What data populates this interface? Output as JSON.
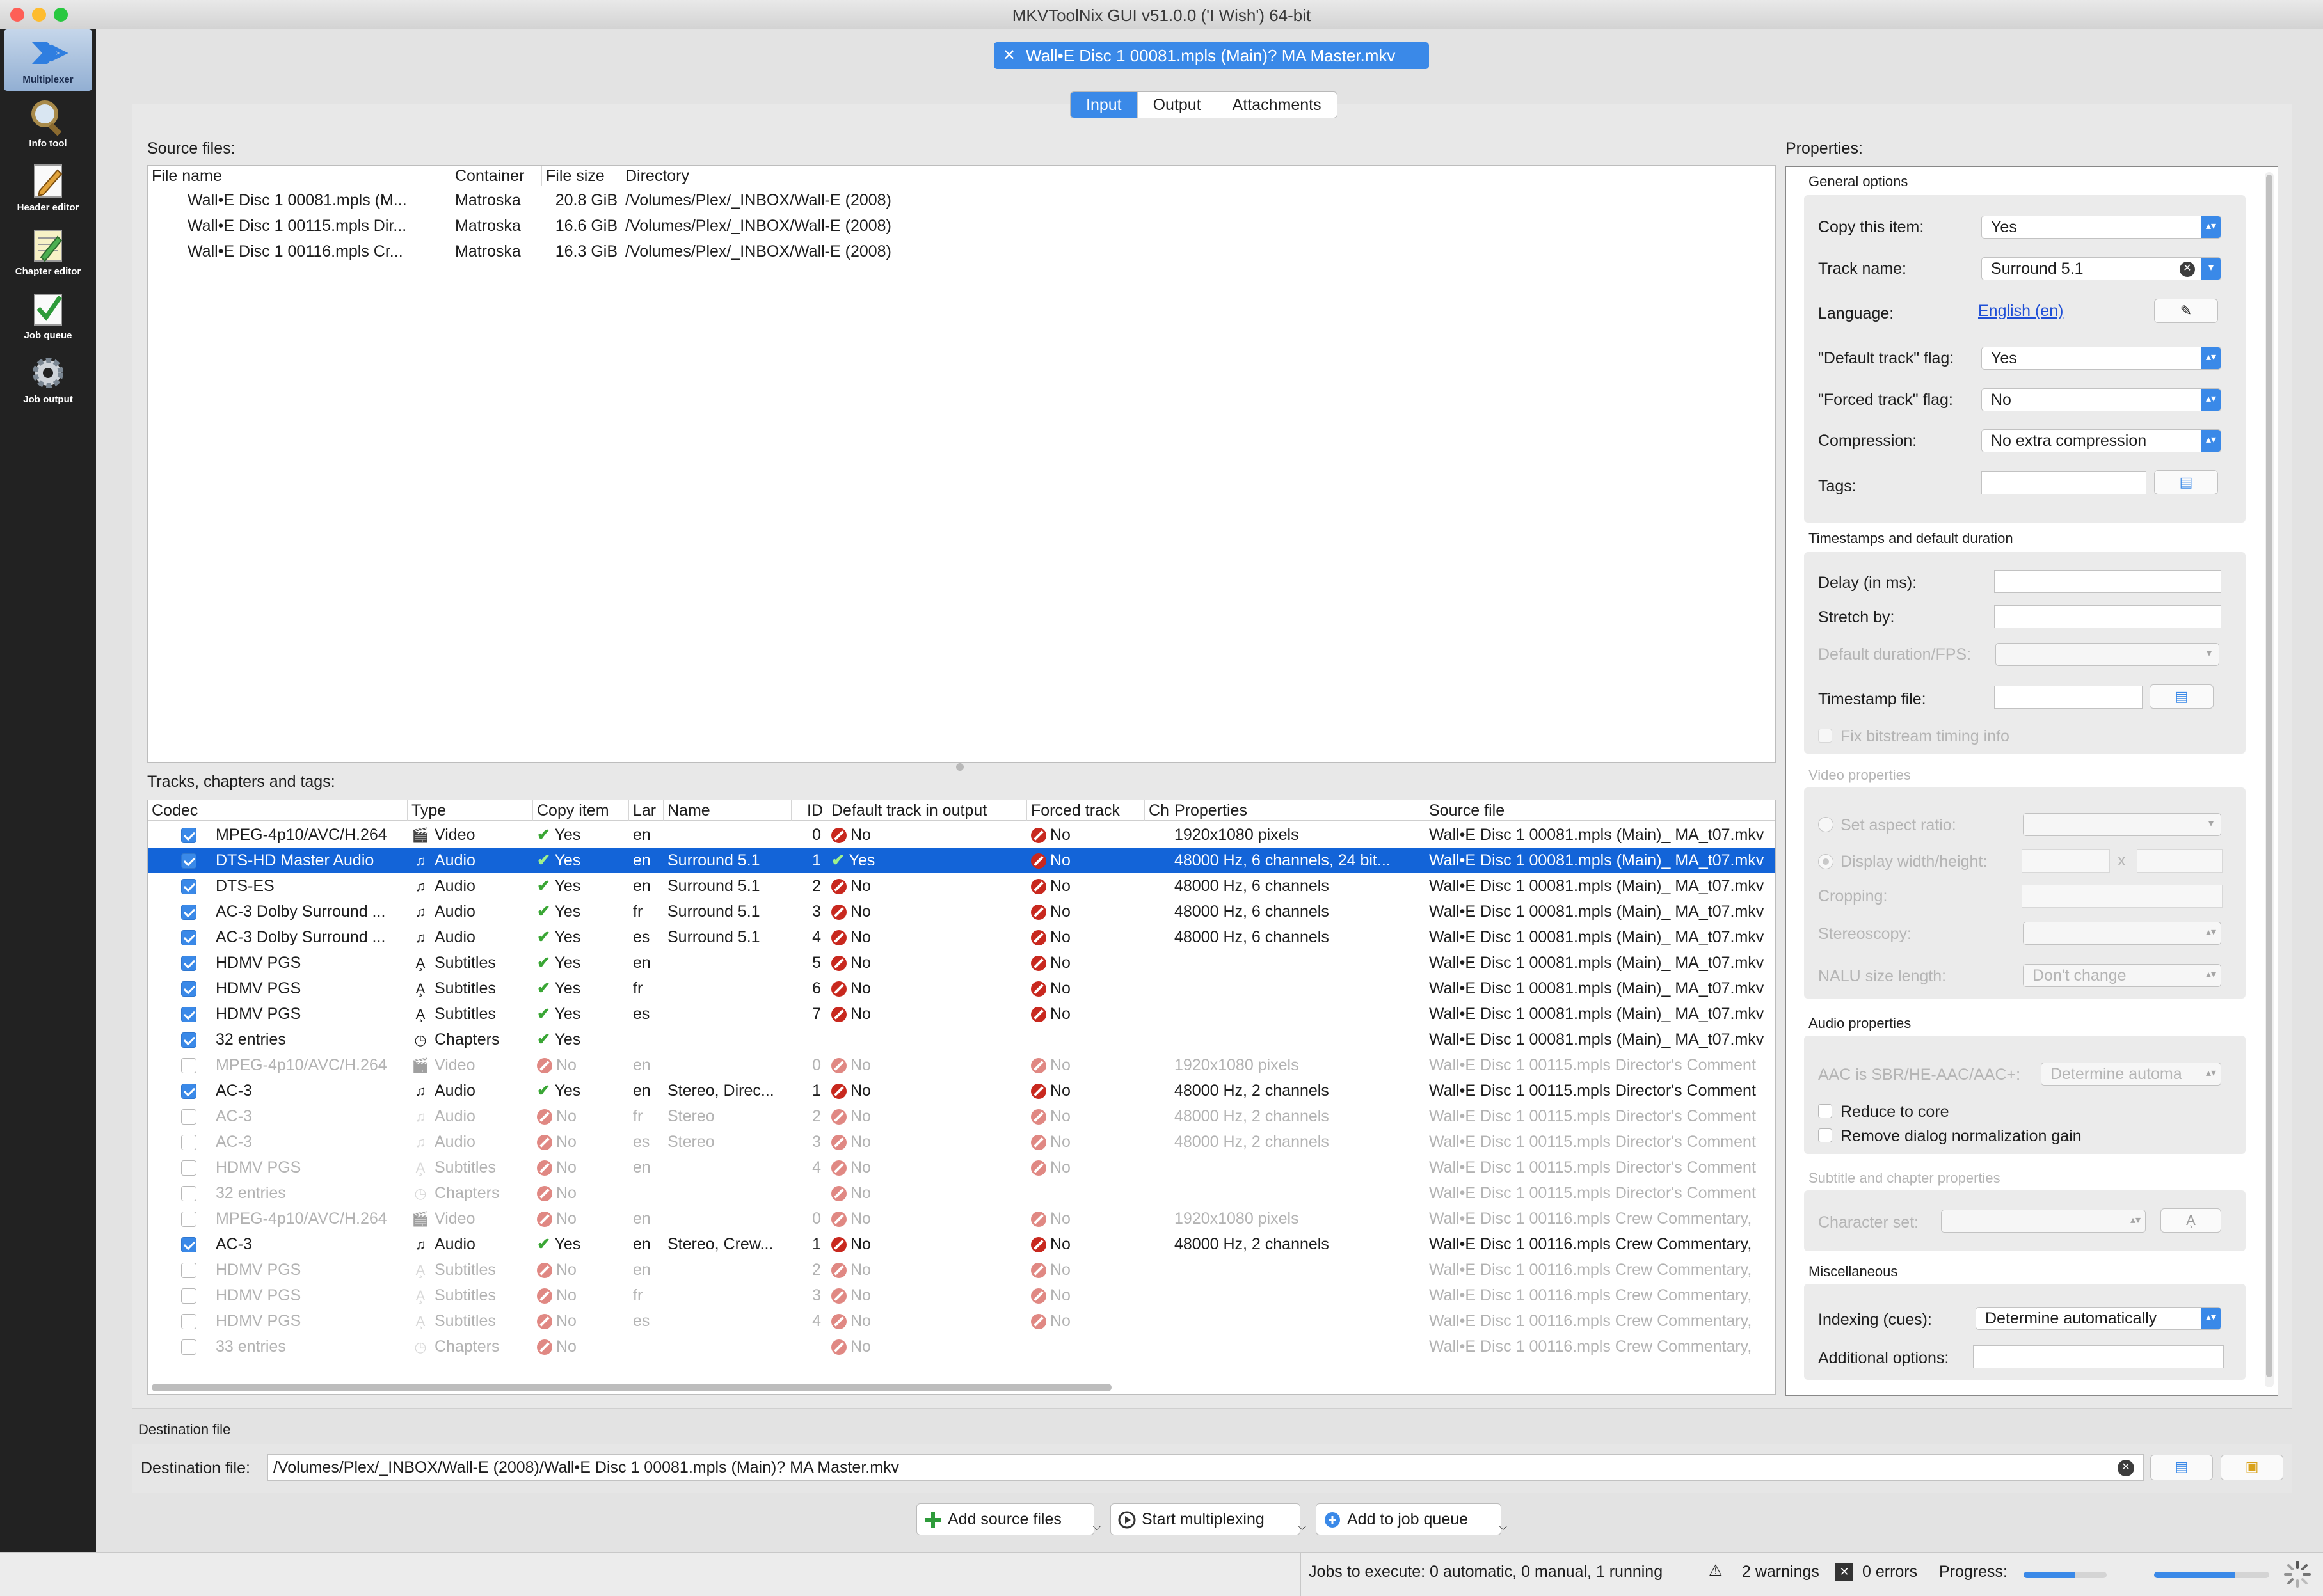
{
  "window": {
    "title": "MKVToolNix GUI v51.0.0 ('I Wish') 64-bit"
  },
  "sidebar": {
    "items": [
      {
        "label": "Multiplexer"
      },
      {
        "label": "Info tool"
      },
      {
        "label": "Header editor"
      },
      {
        "label": "Chapter editor"
      },
      {
        "label": "Job queue"
      },
      {
        "label": "Job output"
      }
    ]
  },
  "file_tab": {
    "label": "Wall•E Disc 1 00081.mpls (Main)? MA Master.mkv",
    "close": "✕"
  },
  "tabs": [
    {
      "label": "Input"
    },
    {
      "label": "Output"
    },
    {
      "label": "Attachments"
    }
  ],
  "source_files": {
    "label": "Source files:",
    "columns": [
      "File name",
      "Container",
      "File size",
      "Directory"
    ],
    "rows": [
      {
        "name": "Wall•E Disc 1 00081.mpls (M...",
        "container": "Matroska",
        "size": "20.8 GiB",
        "dir": "/Volumes/Plex/_INBOX/Wall-E (2008)"
      },
      {
        "name": "Wall•E Disc 1 00115.mpls Dir...",
        "container": "Matroska",
        "size": "16.6 GiB",
        "dir": "/Volumes/Plex/_INBOX/Wall-E (2008)"
      },
      {
        "name": "Wall•E Disc 1 00116.mpls Cr...",
        "container": "Matroska",
        "size": "16.3 GiB",
        "dir": "/Volumes/Plex/_INBOX/Wall-E (2008)"
      }
    ]
  },
  "tracks": {
    "label": "Tracks, chapters and tags:",
    "columns": [
      "Codec",
      "Type",
      "Copy item",
      "Lar",
      "Name",
      "ID",
      "Default track in output",
      "Forced track",
      "Ch",
      "Properties",
      "Source file"
    ],
    "rows": [
      {
        "checked": true,
        "codec": "MPEG-4p10/AVC/H.264",
        "type": "Video",
        "icon": "video",
        "copy": "Yes",
        "lang": "en",
        "name": "",
        "id": "0",
        "def": "No",
        "forced": "No",
        "props": "1920x1080 pixels",
        "src": "Wall•E Disc 1 00081.mpls (Main)_ MA_t07.mkv"
      },
      {
        "checked": true,
        "selected": true,
        "codec": "DTS-HD Master Audio",
        "type": "Audio",
        "icon": "audio",
        "copy": "Yes",
        "lang": "en",
        "name": "Surround 5.1",
        "id": "1",
        "def": "Yes",
        "forced": "No",
        "props": "48000 Hz, 6 channels, 24 bit...",
        "src": "Wall•E Disc 1 00081.mpls (Main)_ MA_t07.mkv"
      },
      {
        "checked": true,
        "codec": "DTS-ES",
        "type": "Audio",
        "icon": "audio",
        "copy": "Yes",
        "lang": "en",
        "name": "Surround 5.1",
        "id": "2",
        "def": "No",
        "forced": "No",
        "props": "48000 Hz, 6 channels",
        "src": "Wall•E Disc 1 00081.mpls (Main)_ MA_t07.mkv"
      },
      {
        "checked": true,
        "codec": "AC-3 Dolby Surround ...",
        "type": "Audio",
        "icon": "audio",
        "copy": "Yes",
        "lang": "fr",
        "name": "Surround 5.1",
        "id": "3",
        "def": "No",
        "forced": "No",
        "props": "48000 Hz, 6 channels",
        "src": "Wall•E Disc 1 00081.mpls (Main)_ MA_t07.mkv"
      },
      {
        "checked": true,
        "codec": "AC-3 Dolby Surround ...",
        "type": "Audio",
        "icon": "audio",
        "copy": "Yes",
        "lang": "es",
        "name": "Surround 5.1",
        "id": "4",
        "def": "No",
        "forced": "No",
        "props": "48000 Hz, 6 channels",
        "src": "Wall•E Disc 1 00081.mpls (Main)_ MA_t07.mkv"
      },
      {
        "checked": true,
        "codec": "HDMV PGS",
        "type": "Subtitles",
        "icon": "subs",
        "copy": "Yes",
        "lang": "en",
        "name": "",
        "id": "5",
        "def": "No",
        "forced": "No",
        "props": "",
        "src": "Wall•E Disc 1 00081.mpls (Main)_ MA_t07.mkv"
      },
      {
        "checked": true,
        "codec": "HDMV PGS",
        "type": "Subtitles",
        "icon": "subs",
        "copy": "Yes",
        "lang": "fr",
        "name": "",
        "id": "6",
        "def": "No",
        "forced": "No",
        "props": "",
        "src": "Wall•E Disc 1 00081.mpls (Main)_ MA_t07.mkv"
      },
      {
        "checked": true,
        "codec": "HDMV PGS",
        "type": "Subtitles",
        "icon": "subs",
        "copy": "Yes",
        "lang": "es",
        "name": "",
        "id": "7",
        "def": "No",
        "forced": "No",
        "props": "",
        "src": "Wall•E Disc 1 00081.mpls (Main)_ MA_t07.mkv"
      },
      {
        "checked": true,
        "codec": "32 entries",
        "type": "Chapters",
        "icon": "chap",
        "copy": "Yes",
        "lang": "",
        "name": "",
        "id": "",
        "def": "",
        "forced": "",
        "props": "",
        "src": "Wall•E Disc 1 00081.mpls (Main)_ MA_t07.mkv"
      },
      {
        "checked": false,
        "disabled": true,
        "codec": "MPEG-4p10/AVC/H.264",
        "type": "Video",
        "icon": "video",
        "copy": "No",
        "lang": "en",
        "name": "",
        "id": "0",
        "def": "No",
        "forced": "No",
        "props": "1920x1080 pixels",
        "src": "Wall•E Disc 1 00115.mpls Director's Comment"
      },
      {
        "checked": true,
        "codec": "AC-3",
        "type": "Audio",
        "icon": "audio",
        "copy": "Yes",
        "lang": "en",
        "name": "Stereo, Direc...",
        "id": "1",
        "def": "No",
        "forced": "No",
        "props": "48000 Hz, 2 channels",
        "src": "Wall•E Disc 1 00115.mpls Director's Comment"
      },
      {
        "checked": false,
        "disabled": true,
        "codec": "AC-3",
        "type": "Audio",
        "icon": "audio",
        "copy": "No",
        "lang": "fr",
        "name": "Stereo",
        "id": "2",
        "def": "No",
        "forced": "No",
        "props": "48000 Hz, 2 channels",
        "src": "Wall•E Disc 1 00115.mpls Director's Comment"
      },
      {
        "checked": false,
        "disabled": true,
        "codec": "AC-3",
        "type": "Audio",
        "icon": "audio",
        "copy": "No",
        "lang": "es",
        "name": "Stereo",
        "id": "3",
        "def": "No",
        "forced": "No",
        "props": "48000 Hz, 2 channels",
        "src": "Wall•E Disc 1 00115.mpls Director's Comment"
      },
      {
        "checked": false,
        "disabled": true,
        "codec": "HDMV PGS",
        "type": "Subtitles",
        "icon": "subs",
        "copy": "No",
        "lang": "en",
        "name": "",
        "id": "4",
        "def": "No",
        "forced": "No",
        "props": "",
        "src": "Wall•E Disc 1 00115.mpls Director's Comment"
      },
      {
        "checked": false,
        "disabled": true,
        "codec": "32 entries",
        "type": "Chapters",
        "icon": "chap",
        "copy": "No",
        "lang": "",
        "name": "",
        "id": "",
        "def": "No",
        "forced": "",
        "props": "",
        "src": "Wall•E Disc 1 00115.mpls Director's Comment"
      },
      {
        "checked": false,
        "disabled": true,
        "codec": "MPEG-4p10/AVC/H.264",
        "type": "Video",
        "icon": "video",
        "copy": "No",
        "lang": "en",
        "name": "",
        "id": "0",
        "def": "No",
        "forced": "No",
        "props": "1920x1080 pixels",
        "src": "Wall•E Disc 1 00116.mpls Crew Commentary,"
      },
      {
        "checked": true,
        "codec": "AC-3",
        "type": "Audio",
        "icon": "audio",
        "copy": "Yes",
        "lang": "en",
        "name": "Stereo, Crew...",
        "id": "1",
        "def": "No",
        "forced": "No",
        "props": "48000 Hz, 2 channels",
        "src": "Wall•E Disc 1 00116.mpls Crew Commentary,"
      },
      {
        "checked": false,
        "disabled": true,
        "codec": "HDMV PGS",
        "type": "Subtitles",
        "icon": "subs",
        "copy": "No",
        "lang": "en",
        "name": "",
        "id": "2",
        "def": "No",
        "forced": "No",
        "props": "",
        "src": "Wall•E Disc 1 00116.mpls Crew Commentary,"
      },
      {
        "checked": false,
        "disabled": true,
        "codec": "HDMV PGS",
        "type": "Subtitles",
        "icon": "subs",
        "copy": "No",
        "lang": "fr",
        "name": "",
        "id": "3",
        "def": "No",
        "forced": "No",
        "props": "",
        "src": "Wall•E Disc 1 00116.mpls Crew Commentary,"
      },
      {
        "checked": false,
        "disabled": true,
        "codec": "HDMV PGS",
        "type": "Subtitles",
        "icon": "subs",
        "copy": "No",
        "lang": "es",
        "name": "",
        "id": "4",
        "def": "No",
        "forced": "No",
        "props": "",
        "src": "Wall•E Disc 1 00116.mpls Crew Commentary,"
      },
      {
        "checked": false,
        "disabled": true,
        "codec": "33 entries",
        "type": "Chapters",
        "icon": "chap",
        "copy": "No",
        "lang": "",
        "name": "",
        "id": "",
        "def": "No",
        "forced": "",
        "props": "",
        "src": "Wall•E Disc 1 00116.mpls Crew Commentary,"
      }
    ]
  },
  "properties": {
    "label": "Properties:",
    "general": {
      "title": "General options",
      "copy_item_label": "Copy this item:",
      "copy_item_value": "Yes",
      "track_name_label": "Track name:",
      "track_name_value": "Surround 5.1",
      "language_label": "Language:",
      "language_value": "English (en)",
      "default_flag_label": "\"Default track\" flag:",
      "default_flag_value": "Yes",
      "forced_flag_label": "\"Forced track\" flag:",
      "forced_flag_value": "No",
      "compression_label": "Compression:",
      "compression_value": "No extra compression",
      "tags_label": "Tags:"
    },
    "timestamps": {
      "title": "Timestamps and default duration",
      "delay_label": "Delay (in ms):",
      "stretch_label": "Stretch by:",
      "default_duration_label": "Default duration/FPS:",
      "timestamp_file_label": "Timestamp file:",
      "fix_bitstream_label": "Fix bitstream timing info"
    },
    "video": {
      "title": "Video properties",
      "aspect_ratio_label": "Set aspect ratio:",
      "display_wh_label": "Display width/height:",
      "wh_separator": "x",
      "cropping_label": "Cropping:",
      "stereoscopy_label": "Stereoscopy:",
      "nalu_label": "NALU size length:",
      "nalu_value": "Don't change"
    },
    "audio": {
      "title": "Audio properties",
      "aac_label": "AAC is SBR/HE-AAC/AAC+:",
      "aac_value": "Determine automa",
      "reduce_core_label": "Reduce to core",
      "remove_dialog_label": "Remove dialog normalization gain"
    },
    "subtitle": {
      "title": "Subtitle and chapter properties",
      "charset_label": "Character set:"
    },
    "misc": {
      "title": "Miscellaneous",
      "indexing_label": "Indexing (cues):",
      "indexing_value": "Determine automatically",
      "additional_label": "Additional options:"
    }
  },
  "destination": {
    "section_label": "Destination file",
    "label": "Destination file:",
    "value": "/Volumes/Plex/_INBOX/Wall-E (2008)/Wall•E Disc 1 00081.mpls (Main)? MA Master.mkv"
  },
  "actions": {
    "add_source": "Add source files",
    "start_mux": "Start multiplexing",
    "add_queue": "Add to job queue"
  },
  "status": {
    "jobs": "Jobs to execute:  0 automatic, 0 manual, 1 running",
    "warnings": "2 warnings",
    "errors": "0 errors",
    "progress_label": "Progress:",
    "progress_current": 0.62,
    "progress_total": 0.7
  },
  "colors": {
    "accent": "#3a89e8",
    "selection": "#1364d8",
    "yes": "#3aa635",
    "no": "#c8281e",
    "sidebar": "#222222"
  }
}
